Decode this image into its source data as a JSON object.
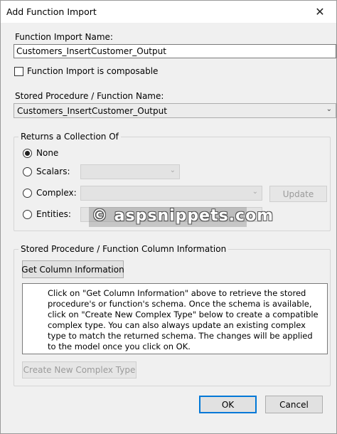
{
  "window": {
    "title": "Add Function Import",
    "close_glyph": "✕"
  },
  "function_import_name": {
    "label": "Function Import Name:",
    "value": "Customers_InsertCustomer_Output"
  },
  "composable": {
    "label": "Function Import is composable",
    "checked": false
  },
  "stored_procedure": {
    "label": "Stored Procedure / Function Name:",
    "value": "Customers_InsertCustomer_Output"
  },
  "returns_collection": {
    "caption": "Returns a Collection Of",
    "options": [
      {
        "label": "None",
        "selected": true
      },
      {
        "label": "Scalars:",
        "selected": false
      },
      {
        "label": "Complex:",
        "selected": false
      },
      {
        "label": "Entities:",
        "selected": false
      }
    ],
    "update_button": "Update"
  },
  "watermark": "© aspsnippets.com",
  "column_info": {
    "caption": "Stored Procedure / Function Column Information",
    "get_button": "Get Column Information",
    "info_text": "Click on \"Get Column Information\" above to retrieve the stored procedure's or function's schema. Once the schema is available, click on \"Create New Complex Type\" below to create a compatible complex type. You can also always update an existing complex type to match the returned schema. The changes will be applied to the model once you click on OK.",
    "create_button": "Create New Complex Type"
  },
  "footer": {
    "ok_button": "OK",
    "cancel_button": "Cancel"
  },
  "icons": {
    "close": "close-icon",
    "chevron": "chevron-down-icon"
  }
}
